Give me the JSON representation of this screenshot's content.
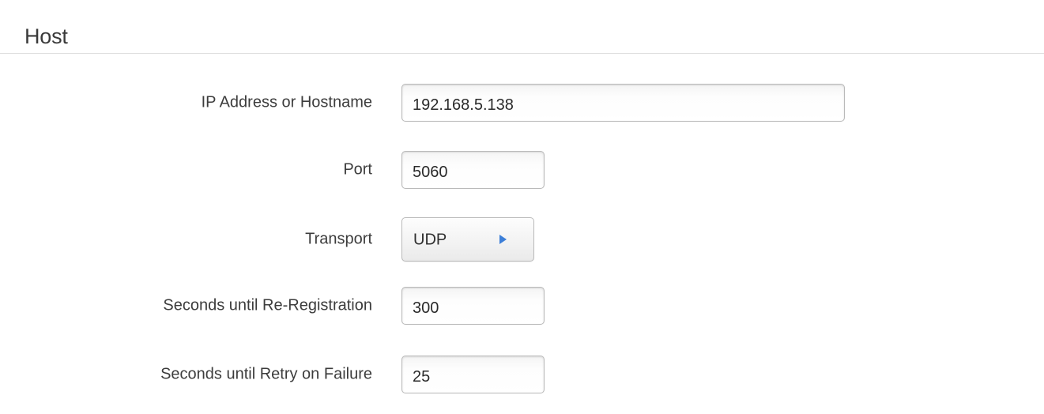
{
  "section": {
    "title": "Host"
  },
  "fields": {
    "host": {
      "label": "IP Address or Hostname",
      "value": "192.168.5.138"
    },
    "port": {
      "label": "Port",
      "value": "5060"
    },
    "transport": {
      "label": "Transport",
      "value": "UDP",
      "icon": "triangle-right-icon"
    },
    "reregistration": {
      "label": "Seconds until Re-Registration",
      "value": "300"
    },
    "retry": {
      "label": "Seconds until Retry on Failure",
      "value": "25"
    }
  },
  "colors": {
    "accent": "#3d7fd8",
    "divider": "#dddddd",
    "field_border": "#b9b9b9"
  }
}
